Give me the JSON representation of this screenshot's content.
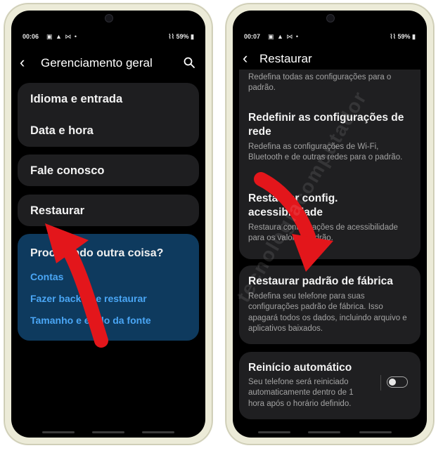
{
  "left_phone": {
    "status": {
      "time": "00:06",
      "icons": "▣ ▲ ⋈ •",
      "signal": "⌇⌇",
      "battery": "59%"
    },
    "header": {
      "title": "Gerenciamento geral"
    },
    "menu": {
      "idioma": "Idioma e entrada",
      "data_hora": "Data e hora",
      "fale_conosco": "Fale conosco",
      "restaurar": "Restaurar"
    },
    "help": {
      "title": "Procurando outra coisa?",
      "links": [
        "Contas",
        "Fazer backup e restaurar",
        "Tamanho e estilo da fonte"
      ]
    }
  },
  "right_phone": {
    "status": {
      "time": "00:07",
      "icons": "▣ ▲ ⋈ •",
      "signal": "⌇⌇",
      "battery": "59%"
    },
    "header": {
      "title": "Restaurar"
    },
    "items": {
      "top_desc": "Redefina todas as configurações para o padrão.",
      "rede_title": "Redefinir as configurações de rede",
      "rede_desc": "Redefina as configurações de Wi-Fi, Bluetooth e de outras redes para o padrão.",
      "acess_title": "Restaurar config. acessibilidade",
      "acess_desc": "Restaura configurações de acessibilidade para os valores padrão.",
      "fabrica_title": "Restaurar padrão de fábrica",
      "fabrica_desc": "Redefina seu telefone para suas configurações padrão de fábrica. Isso apagará todos os dados, incluindo arquivo e aplicativos baixados.",
      "reinicio_title": "Reinício automático",
      "reinicio_desc": "Seu telefone será reiniciado automaticamente dentro de 1 hora após o horário definido.",
      "reinicio_enabled": false
    }
  },
  "watermark": "tecnologiacomputador",
  "colors": {
    "arrow": "#e3161b",
    "link": "#4aa6f5",
    "help_bg": "#0e3a5e",
    "card": "#1e1e20"
  }
}
